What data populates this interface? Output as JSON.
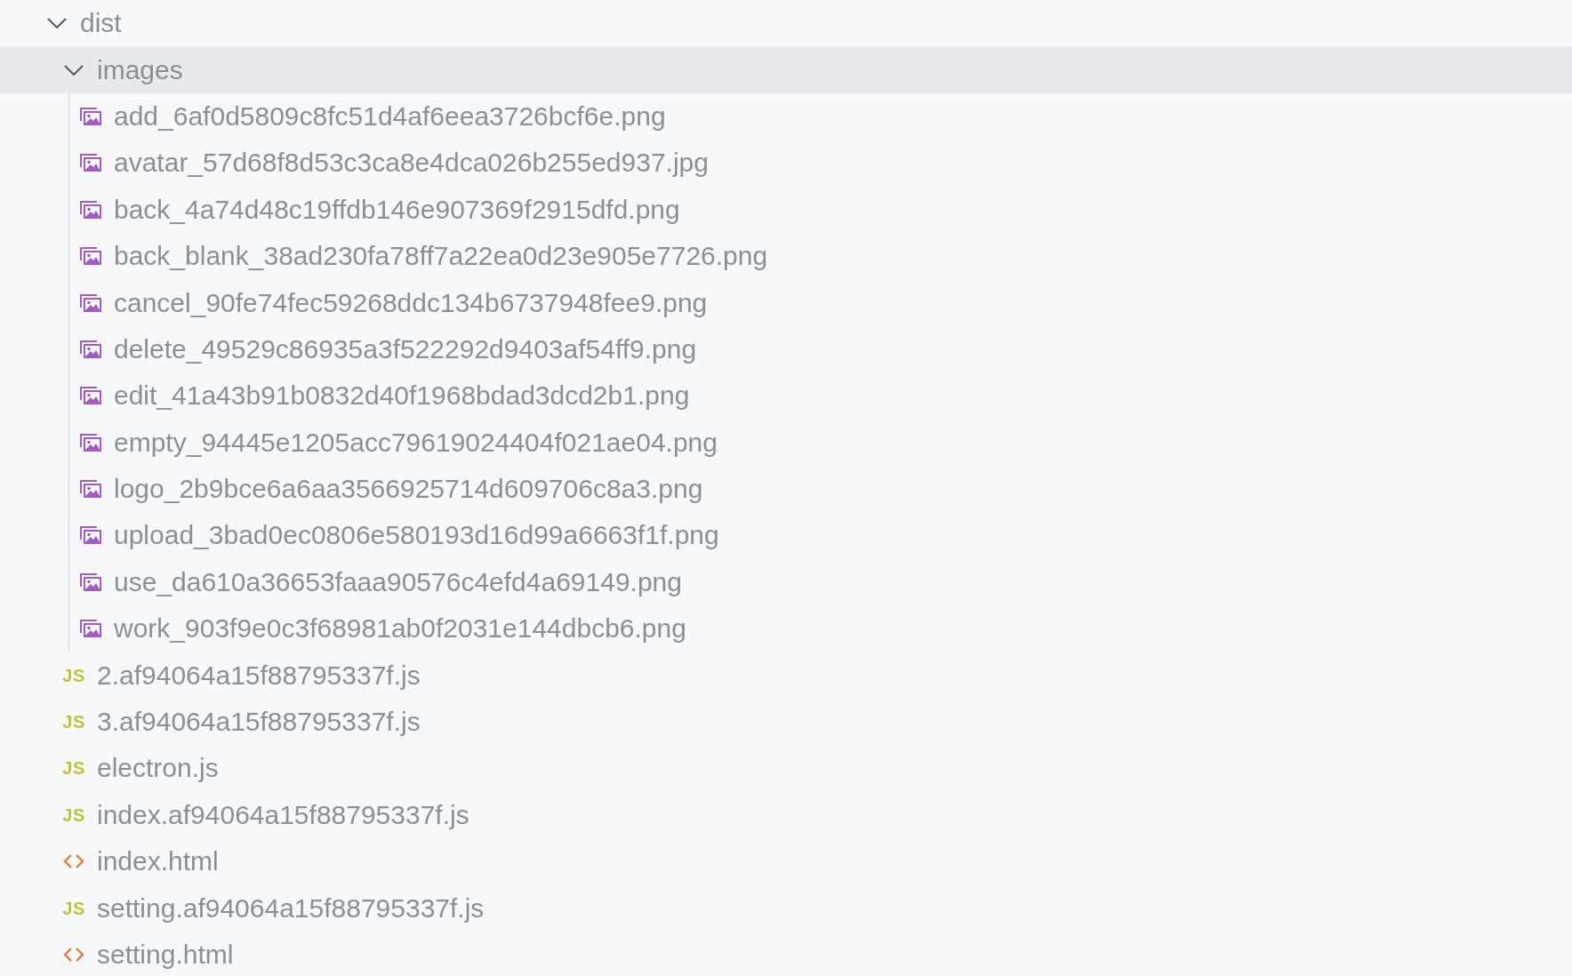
{
  "tree": [
    {
      "kind": "folder",
      "label": "dist",
      "expanded": true,
      "selected": false,
      "children": [
        {
          "kind": "folder",
          "label": "images",
          "expanded": true,
          "selected": true,
          "children": [
            {
              "kind": "image",
              "label": "add_6af0d5809c8fc51d4af6eea3726bcf6e.png",
              "selected": false
            },
            {
              "kind": "image",
              "label": "avatar_57d68f8d53c3ca8e4dca026b255ed937.jpg",
              "selected": false
            },
            {
              "kind": "image",
              "label": "back_4a74d48c19ffdb146e907369f2915dfd.png",
              "selected": false
            },
            {
              "kind": "image",
              "label": "back_blank_38ad230fa78ff7a22ea0d23e905e7726.png",
              "selected": false
            },
            {
              "kind": "image",
              "label": "cancel_90fe74fec59268ddc134b6737948fee9.png",
              "selected": false
            },
            {
              "kind": "image",
              "label": "delete_49529c86935a3f522292d9403af54ff9.png",
              "selected": false
            },
            {
              "kind": "image",
              "label": "edit_41a43b91b0832d40f1968bdad3dcd2b1.png",
              "selected": false
            },
            {
              "kind": "image",
              "label": "empty_94445e1205acc79619024404f021ae04.png",
              "selected": false
            },
            {
              "kind": "image",
              "label": "logo_2b9bce6a6aa3566925714d609706c8a3.png",
              "selected": false
            },
            {
              "kind": "image",
              "label": "upload_3bad0ec0806e580193d16d99a6663f1f.png",
              "selected": false
            },
            {
              "kind": "image",
              "label": "use_da610a36653faaa90576c4efd4a69149.png",
              "selected": false
            },
            {
              "kind": "image",
              "label": "work_903f9e0c3f68981ab0f2031e144dbcb6.png",
              "selected": false
            }
          ]
        },
        {
          "kind": "js",
          "icon_text": "JS",
          "label": "2.af94064a15f88795337f.js",
          "selected": false
        },
        {
          "kind": "js",
          "icon_text": "JS",
          "label": "3.af94064a15f88795337f.js",
          "selected": false
        },
        {
          "kind": "js",
          "icon_text": "JS",
          "label": "electron.js",
          "selected": false
        },
        {
          "kind": "js",
          "icon_text": "JS",
          "label": "index.af94064a15f88795337f.js",
          "selected": false
        },
        {
          "kind": "html",
          "label": "index.html",
          "selected": false
        },
        {
          "kind": "js",
          "icon_text": "JS",
          "label": "setting.af94064a15f88795337f.js",
          "selected": false
        },
        {
          "kind": "html",
          "label": "setting.html",
          "selected": false
        }
      ]
    }
  ]
}
